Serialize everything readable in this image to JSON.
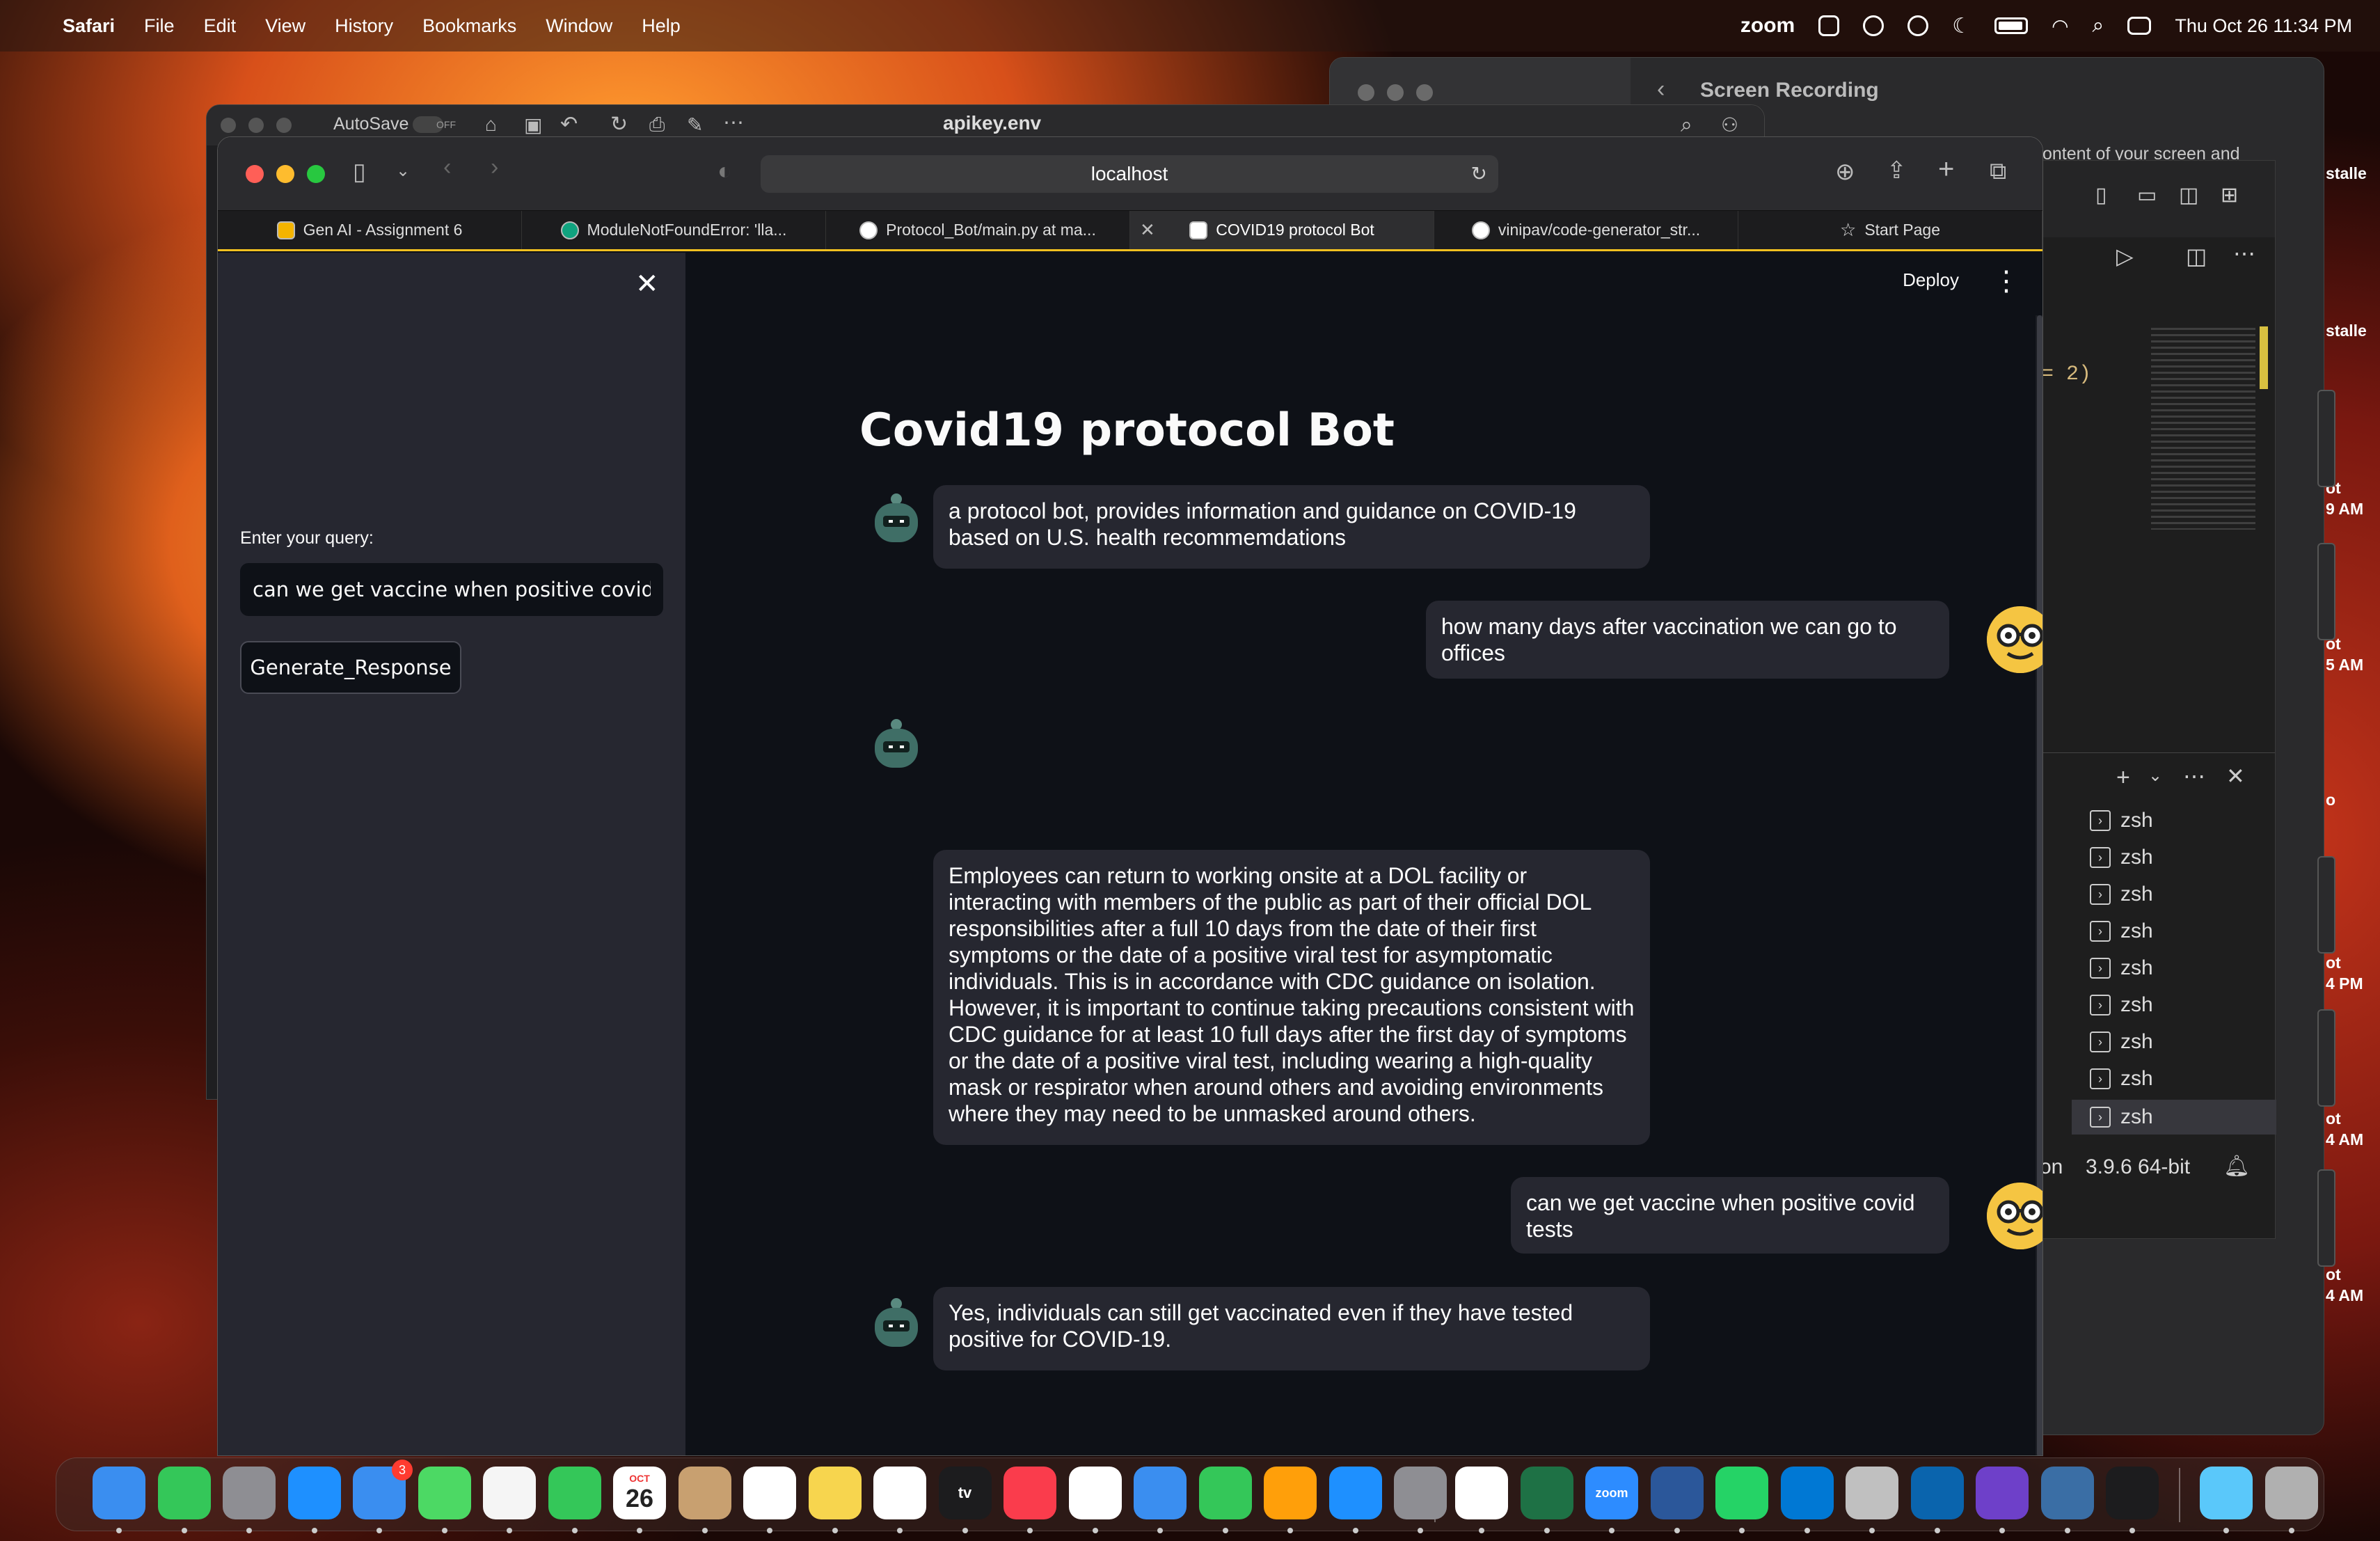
{
  "menubar": {
    "app": "Safari",
    "items": [
      "File",
      "Edit",
      "View",
      "History",
      "Bookmarks",
      "Window",
      "Help"
    ],
    "zoom": "zoom",
    "datetime": "Thu Oct 26  11:34 PM"
  },
  "bg_windows": {
    "screen_recording_title": "Screen Recording",
    "screen_recording_text": "ontent of your screen and",
    "pages_autosave": "AutoSave",
    "pages_autosave_state": "OFF",
    "pages_file": "apikey.env",
    "side_fragments": [
      "stalle",
      "stalle",
      "ot",
      "9 AM",
      "ot",
      "5 AM",
      "ot",
      "4 PM",
      "ot",
      "4 AM",
      "ot",
      "4 AM",
      "o"
    ],
    "code_fragment": "= 2)",
    "terminals": [
      "zsh",
      "zsh",
      "zsh",
      "zsh",
      "zsh",
      "zsh",
      "zsh",
      "zsh",
      "zsh"
    ],
    "python_prefix": "on",
    "python_version": "3.9.6 64-bit"
  },
  "safari": {
    "address": "localhost",
    "tabs": [
      {
        "label": "Gen AI - Assignment 6"
      },
      {
        "label": "ModuleNotFoundError: 'lla..."
      },
      {
        "label": "Protocol_Bot/main.py at ma..."
      },
      {
        "label": "COVID19 protocol Bot"
      },
      {
        "label": "vinipav/code-generator_str..."
      },
      {
        "label": "Start Page"
      }
    ]
  },
  "app": {
    "sidebar": {
      "query_label": "Enter your query:",
      "query_value": "can we get vaccine when positive covid test",
      "button_label": "Generate_Response"
    },
    "header": {
      "deploy": "Deploy"
    },
    "title": "Covid19 protocol Bot",
    "messages": [
      {
        "role": "bot",
        "text": "a protocol bot, provides information and guidance on COVID-19 based on U.S. health recommemdations"
      },
      {
        "role": "user",
        "text": "how many days after vaccination we can go to offices"
      },
      {
        "role": "bot",
        "text": "Employees can return to working onsite at a DOL facility or interacting with members of the public as part of their official DOL responsibilities after a full 10 days from the date of their first symptoms or the date of a positive viral test for asymptomatic individuals. This is in accordance with CDC guidance on isolation. However, it is important to continue taking precautions consistent with CDC guidance for at least 10 full days after the first day of symptoms or the date of a positive viral test, including wearing a high-quality mask or respirator when around others and avoiding environments where they may need to be unmasked around others."
      },
      {
        "role": "user",
        "text": "can we get vaccine when positive covid tests"
      },
      {
        "role": "bot",
        "text": "Yes, individuals can still get vaccinated even if they have tested positive for COVID-19."
      }
    ]
  },
  "dock": {
    "mail_badge": "3",
    "calendar_month": "OCT",
    "calendar_day": "26",
    "tv_label": "tv",
    "zoom_label": "zoom",
    "icons": [
      "finder-icon",
      "messages-icon",
      "launchpad-icon",
      "safari-icon",
      "mail-icon",
      "maps-icon",
      "photos-icon",
      "facetime-icon",
      "calendar-icon",
      "contacts-icon",
      "reminders-icon",
      "notes-icon",
      "freeform-icon",
      "tv-icon",
      "music-icon",
      "news-icon",
      "keynote-icon",
      "numbers-icon",
      "pages-icon",
      "appstore-icon",
      "settings-icon",
      "chatgpt-icon",
      "excel-icon",
      "zoom-icon",
      "word-icon",
      "whatsapp-icon",
      "vscode-icon",
      "downloads-icon",
      "outlook-icon",
      "github-icon",
      "feather-icon",
      "terminal-icon",
      "folder-icon",
      "trash-icon"
    ],
    "colors": [
      "#3a8ef0",
      "#34c759",
      "#8e8e93",
      "#1e90ff",
      "#3a8ef0",
      "#4cd964",
      "#f5f5f5",
      "#34c759",
      "#ffffff",
      "#c8a070",
      "#ffffff",
      "#f7d54e",
      "#ffffff",
      "#1c1c1e",
      "#fa3c4c",
      "#ffffff",
      "#3a8ef0",
      "#34c759",
      "#ff9f0a",
      "#1e90ff",
      "#8e8e93",
      "#ffffff",
      "#1e7145",
      "#2d8cff",
      "#2b579a",
      "#25d366",
      "#0078d4",
      "#c0c0c0",
      "#0a64ad",
      "#6e40c9",
      "#3a6ea5",
      "#1c1c1e",
      "#5ac8fa",
      "#b0b0b0"
    ]
  }
}
